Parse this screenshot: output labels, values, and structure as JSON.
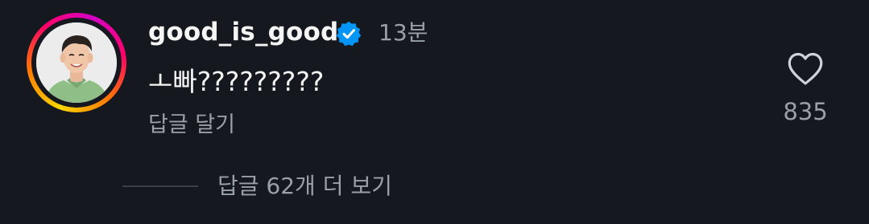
{
  "comment": {
    "username": "good_is_good",
    "time_ago": "13분",
    "text": "ㅗ빠?????????",
    "reply_label": "답글 달기",
    "like_count": "835",
    "view_replies_label": "답글 62개 더 보기",
    "verified": true
  },
  "icons": {
    "verified": "verified-badge-icon",
    "like": "heart-outline-icon"
  },
  "colors": {
    "background": "#15191f",
    "primary_text": "#f5f5f5",
    "secondary_text": "#9aa0a8",
    "verified_blue": "#0095f6"
  }
}
